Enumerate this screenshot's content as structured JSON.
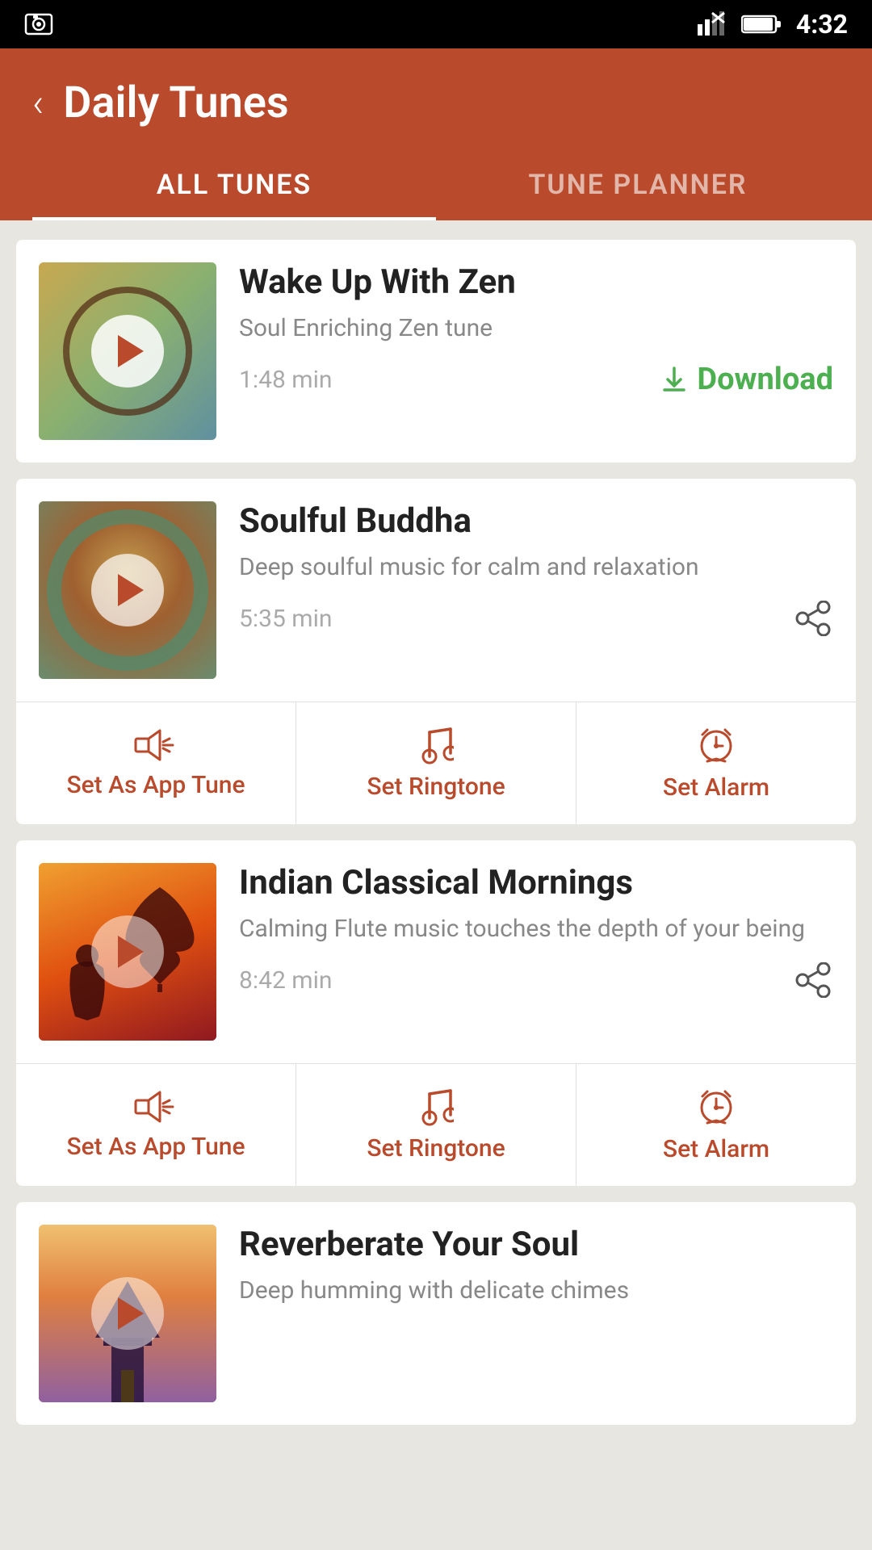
{
  "statusBar": {
    "time": "4:32",
    "icons": [
      "signal",
      "battery"
    ]
  },
  "header": {
    "backLabel": "‹",
    "title": "Daily Tunes"
  },
  "tabs": [
    {
      "id": "all-tunes",
      "label": "ALL TUNES",
      "active": true
    },
    {
      "id": "tune-planner",
      "label": "TUNE PLANNER",
      "active": false
    }
  ],
  "tracks": [
    {
      "id": "wake-up-zen",
      "title": "Wake Up With Zen",
      "subtitle": "Soul Enriching Zen tune",
      "duration": "1:48 min",
      "thumbClass": "thumb-zen",
      "action": "download",
      "downloadLabel": "Download",
      "hasActionBar": false
    },
    {
      "id": "soulful-buddha",
      "title": "Soulful Buddha",
      "subtitle": "Deep soulful music for calm and relaxation",
      "duration": "5:35 min",
      "thumbClass": "thumb-buddha",
      "action": "share",
      "hasActionBar": true,
      "actionBar": [
        {
          "id": "set-app-tune-1",
          "label": "Set As App Tune",
          "icon": "speaker"
        },
        {
          "id": "set-ringtone-1",
          "label": "Set Ringtone",
          "icon": "music"
        },
        {
          "id": "set-alarm-1",
          "label": "Set Alarm",
          "icon": "alarm"
        }
      ]
    },
    {
      "id": "indian-classical",
      "title": "Indian Classical Mornings",
      "subtitle": "Calming Flute music touches the depth of your being",
      "duration": "8:42 min",
      "thumbClass": "thumb-indian",
      "action": "share",
      "hasActionBar": true,
      "actionBar": [
        {
          "id": "set-app-tune-2",
          "label": "Set As App Tune",
          "icon": "speaker"
        },
        {
          "id": "set-ringtone-2",
          "label": "Set Ringtone",
          "icon": "music"
        },
        {
          "id": "set-alarm-2",
          "label": "Set Alarm",
          "icon": "alarm"
        }
      ]
    },
    {
      "id": "reverberate-soul",
      "title": "Reverberate Your Soul",
      "subtitle": "Deep humming with delicate chimes",
      "duration": "",
      "thumbClass": "thumb-reverberate",
      "action": "none",
      "hasActionBar": false,
      "partial": true
    }
  ],
  "icons": {
    "download": "⬇",
    "share": "⋯",
    "speaker": "🔊",
    "music": "♪",
    "alarm": "⏰"
  }
}
